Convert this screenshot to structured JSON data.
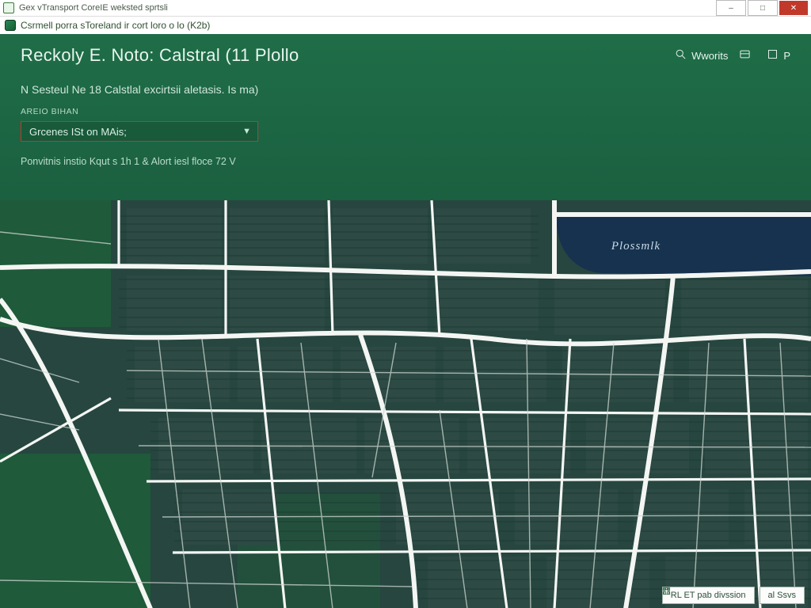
{
  "window": {
    "title": "Gex vTransport CoreIE weksted sprtsli",
    "subtitle": "Csrmell porra sToreland ir cort loro o lo (K2b)"
  },
  "titlebar_controls": {
    "minimize": "–",
    "maximize": "□",
    "close": "✕"
  },
  "header": {
    "title": "Reckoly E. Noto: Calstral (11 Plollo",
    "search_label": "Wworits",
    "layers_label": "",
    "print_label": "P",
    "subtitle": "N Sesteul Ne 18 Calstlal excirtsii aletasis. Is ma)",
    "field_label": "AREIO BIHAN",
    "select_value": "Grcenes ISt on MAis;",
    "hint": "Ponvitnis instio Kqut s 1h 1 &   Alort iesl floce 72 V"
  },
  "map": {
    "river_label": "Plossmlk"
  },
  "map_buttons": {
    "distribution": "RL ET pab divssion",
    "save": "al Ssvs"
  },
  "colors": {
    "header_bg": "#1e6b46",
    "select_border": "#c0392b",
    "water": "#16324e",
    "land": "#2d4a44",
    "road": "#f4f6f3"
  }
}
